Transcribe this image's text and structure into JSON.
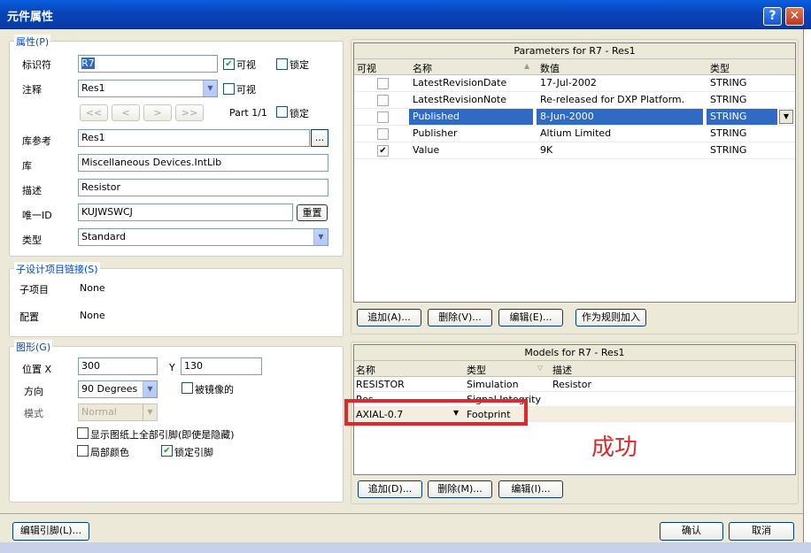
{
  "window": {
    "title": "元件属性",
    "help": "?",
    "close": "✕"
  },
  "properties": {
    "group_title": "属性(P)",
    "designator_label": "标识符",
    "designator_value": "R7",
    "visible_label": "可视",
    "locked_label": "锁定",
    "comment_label": "注释",
    "comment_value": "Res1",
    "nav": [
      "<<",
      "<",
      ">",
      ">>"
    ],
    "part_label": "Part 1/1",
    "libref_label": "库参考",
    "libref_value": "Res1",
    "browse": "...",
    "library_label": "库",
    "library_value": "Miscellaneous Devices.IntLib",
    "desc_label": "描述",
    "desc_value": "Resistor",
    "uid_label": "唯一ID",
    "uid_value": "KUJWSWCJ",
    "reset": "重置",
    "type_label": "类型",
    "type_value": "Standard"
  },
  "subdesign": {
    "group_title": "子设计项目链接(S)",
    "sub_label": "子项目",
    "sub_value": "None",
    "config_label": "配置",
    "config_value": "None"
  },
  "graphics": {
    "group_title": "图形(G)",
    "location_label": "位置 X",
    "x": "300",
    "y_label": "Y",
    "y": "130",
    "orientation_label": "方向",
    "orientation": "90 Degrees",
    "mirrored": "被镜像的",
    "mode_label": "模式",
    "mode": "Normal",
    "show_pins": "显示图纸上全部引脚(即使是隐藏)",
    "local_colors": "局部颜色",
    "lock_pins": "锁定引脚"
  },
  "parameters": {
    "title": "Parameters for R7 - Res1",
    "columns": [
      "可视",
      "名称",
      "数值",
      "类型"
    ],
    "rows": [
      {
        "visible": false,
        "name": "LatestRevisionDate",
        "value": "17-Jul-2002",
        "type": "STRING"
      },
      {
        "visible": false,
        "name": "LatestRevisionNote",
        "value": "Re-released for DXP Platform.",
        "type": "STRING"
      },
      {
        "visible": false,
        "name": "Published",
        "value": "8-Jun-2000",
        "type": "STRING",
        "selected": true
      },
      {
        "visible": false,
        "name": "Publisher",
        "value": "Altium Limited",
        "type": "STRING"
      },
      {
        "visible": true,
        "name": "Value",
        "value": "9K",
        "type": "STRING"
      }
    ],
    "buttons": [
      "追加(A)...",
      "删除(V)...",
      "编辑(E)...",
      "作为规则加入"
    ]
  },
  "models": {
    "title": "Models for R7 - Res1",
    "columns": [
      "名称",
      "类型",
      "描述"
    ],
    "rows": [
      {
        "name": "RESISTOR",
        "type": "Simulation",
        "desc": "Resistor"
      },
      {
        "name": "Res",
        "type": "Signal Integrity",
        "desc": ""
      },
      {
        "name": "AXIAL-0.7",
        "type": "Footprint",
        "desc": ""
      }
    ],
    "annotation": "成功",
    "buttons": [
      "追加(D)...",
      "删除(M)...",
      "编辑(I)..."
    ]
  },
  "footer": {
    "edit_pins": "编辑引脚(L)...",
    "ok": "确认",
    "cancel": "取消"
  },
  "colors": {
    "title_bar": "#0844b8",
    "selection": "#316ac5",
    "annotation": "#e0282a"
  }
}
